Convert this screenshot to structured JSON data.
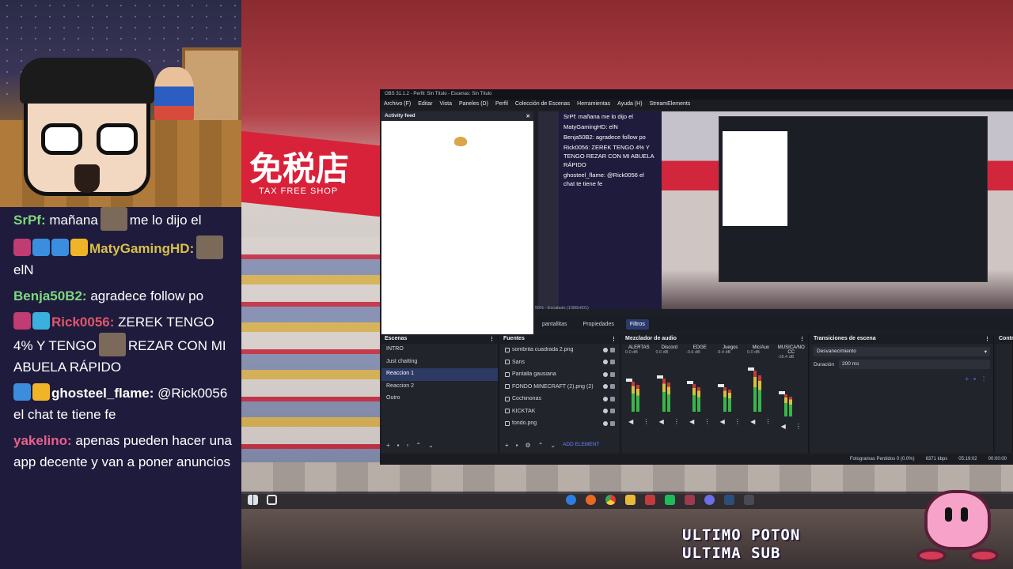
{
  "chat": {
    "messages": [
      {
        "user": "SrPf:",
        "user_color": "#7dd87d",
        "text": "mañana",
        "after": "me lo dijo el",
        "badges": []
      },
      {
        "user": "MatyGamingHD:",
        "user_color": "#d8c04a",
        "text": "",
        "after": "elN",
        "badges": [
          "#c03c72",
          "#3b8ede",
          "#3b8ede",
          "#f0b429"
        ]
      },
      {
        "user": "Benja50B2:",
        "user_color": "#7dd87d",
        "text": "agradece follow po",
        "after": "",
        "badges": []
      },
      {
        "user": "Rick0056:",
        "user_color": "#e0566b",
        "text": "ZEREK TENGO 4% Y TENGO",
        "after": "REZAR CON MI ABUELA RÁPIDO",
        "badges": [
          "#c03c72",
          "#3bb0de"
        ]
      },
      {
        "user": "ghosteel_flame:",
        "user_color": "#ffffff",
        "text": "@Rick0056 el chat te tiene fe",
        "after": "",
        "badges": [
          "#3b8ede",
          "#f0b429"
        ]
      },
      {
        "user": "yakelino:",
        "user_color": "#e8618a",
        "text": "apenas pueden hacer una app decente y van a poner anuncios",
        "after": "",
        "badges": []
      }
    ]
  },
  "scene_sign": {
    "main": "免税店",
    "sub": "TAX FREE SHOP"
  },
  "obs": {
    "title": "OBS 31.1.2 - Perfil: Sin Título - Escenas: Sin Título",
    "menu": [
      "Archivo (F)",
      "Editar",
      "Vista",
      "Paneles (D)",
      "Perfil",
      "Colección de Escenas",
      "Herramientas",
      "Ayuda (H)",
      "StreamElements"
    ],
    "activity_feed": "Activity feed",
    "preview_chat": [
      "SrPf: mañana me lo dijo el",
      "MatyGamingHD: elN",
      "Benja50B2: agradece follow po",
      "Rick0056: ZEREK TENGO 4% Y TENGO REZAR CON MI ABUELA RÁPIDO",
      "ghosteel_flame: @Rick0056 el chat te tiene fe"
    ],
    "scale_status": "Escalado (1088x601)",
    "zoom": "55%",
    "source_tab": "pantallitas",
    "props_tab": "Propiedades",
    "filters_tab": "Filtros",
    "scenes": {
      "title": "Escenas",
      "items": [
        "INTRO",
        "Just chatting",
        "Reaccion 1",
        "Reaccion 2",
        "Outro"
      ],
      "selected": "Reaccion 1"
    },
    "sources": {
      "title": "Fuentes",
      "items": [
        "sombrita cuadrada 2.png",
        "Sans",
        "Pantalla gausiana",
        "FONDO MINECRAFT (2).png (2)",
        "Cochinonas",
        "KICKTAK",
        "fondo.png"
      ],
      "add_label": "ADD ELEMENT"
    },
    "mixer": {
      "title": "Mezclador de audio",
      "channels": [
        {
          "name": "ALERTAS",
          "db": "0.0 dB",
          "level": 0.55
        },
        {
          "name": "Discord",
          "db": "0.0 dB",
          "level": 0.6
        },
        {
          "name": "EDGE",
          "db": "-0.6 dB",
          "level": 0.5
        },
        {
          "name": "Juegos",
          "db": "-9.4 dB",
          "level": 0.45
        },
        {
          "name": "Mic/Aux",
          "db": "0.0 dB",
          "level": 0.75
        },
        {
          "name": "MUSICA/NO CC",
          "db": "-18.4 dB",
          "level": 0.4
        }
      ]
    },
    "transitions": {
      "title": "Transiciones de escena",
      "selected": "Desvanecimiento",
      "duration_label": "Duración",
      "duration_value": "200 ms"
    },
    "controls_title": "Contro",
    "status": {
      "dropped": "Fotogramas Perdidos 0 (0.0%)",
      "bitrate": "6371 kbps",
      "time1": "05:19:02",
      "time2": "00:00:00"
    }
  },
  "overlay": {
    "line1": "ULTIMO POTON",
    "line2": "ULTIMA SUB"
  }
}
